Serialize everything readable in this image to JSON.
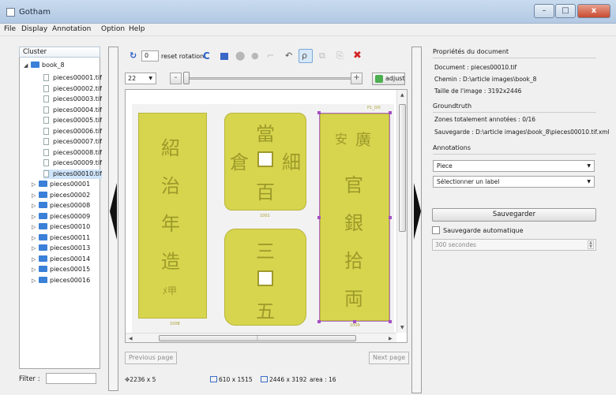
{
  "window": {
    "title": "Gotham",
    "minimize": "–",
    "maximize": "□",
    "close": "x"
  },
  "menu": [
    "File",
    "Display",
    "Annotation",
    "Option",
    "Help"
  ],
  "cluster": {
    "header": "Cluster",
    "root": "book_8",
    "files": [
      "pieces00001.tif",
      "pieces00002.tif",
      "pieces00003.tif",
      "pieces00004.tif",
      "pieces00005.tif",
      "pieces00006.tif",
      "pieces00007.tif",
      "pieces00008.tif",
      "pieces00009.tif",
      "pieces00010.tif"
    ],
    "selected_file": "pieces00010.tif",
    "folders": [
      "pieces00001",
      "pieces00002",
      "pieces00008",
      "pieces00009",
      "pieces00010",
      "pieces00011",
      "pieces00013",
      "pieces00014",
      "pieces00015",
      "pieces00016"
    ],
    "filter_label": "Filter :",
    "filter_value": ""
  },
  "toolbar": {
    "rotation_value": "0",
    "reset_label": "reset rotation"
  },
  "zoom": {
    "value": "22",
    "minus": "-",
    "plus": "+",
    "adjust_label": "adjust"
  },
  "navigation": {
    "previous": "Previous page",
    "next": "Next page"
  },
  "status": {
    "cursor": "2236 x 5",
    "zone_size": "610 x 1515",
    "image_size": "2446 x 3192",
    "area": "area : 16"
  },
  "properties": {
    "title": "Propriétés du document",
    "document": "Document : pieces00010.tif",
    "chemin": "Chemin : D:\\article images\\book_8",
    "taille": "Taille de l'image : 3192x2446"
  },
  "groundtruth": {
    "title": "Groundtruth",
    "zones": "Zones totalement annotées : 0/16",
    "sauvegarde": "Sauvegarde : D:\\article images\\book_8\\pieces00010.tif.xml"
  },
  "annotations": {
    "title": "Annotations",
    "type_value": "Piece",
    "label_value": "Sélectionner un label",
    "save_button": "Sauvegarder",
    "autosave_label": "Sauvegarde automatique",
    "interval_value": "300 secondes"
  },
  "image_labels": {
    "plate_right_top": "P1_0/0",
    "coin_middle": "1001",
    "left_bottom": "1008",
    "right_bottom": "1009"
  },
  "coins": {
    "left": [
      "紹",
      "治",
      "年",
      "造",
      "ﾒ甲"
    ],
    "center_top": [
      "當",
      "百",
      "倉",
      "細"
    ],
    "center_bottom": [
      "三",
      "五"
    ],
    "right": [
      "廣",
      "安",
      "官",
      "銀",
      "拾",
      "両"
    ]
  }
}
